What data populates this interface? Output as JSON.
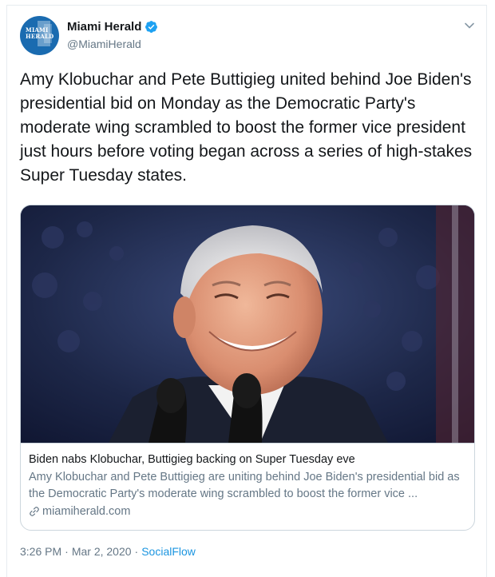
{
  "account": {
    "display_name": "Miami Herald",
    "handle": "@MiamiHerald",
    "avatar_text_line1": "MIAMI",
    "avatar_text_line2": "HERALD",
    "brand_color": "#1a6bb0",
    "verified_color": "#1da1f2"
  },
  "tweet": {
    "text": "Amy Klobuchar and Pete Buttigieg united behind Joe Biden's presidential bid on Monday as the Democratic Party's moderate wing scrambled to boost the former vice president just hours before voting began across a series of high-stakes Super Tuesday states."
  },
  "card": {
    "title": "Biden nabs Klobuchar, Buttigieg backing on Super Tuesday eve",
    "description": "Amy Klobuchar and Pete Buttigieg are uniting behind Joe Biden's presidential bid as the Democratic Party's moderate wing scrambled to boost the former vice ...",
    "domain": "miamiherald.com",
    "image_icon": "photo-of-joe-biden-smiling-at-microphones"
  },
  "meta": {
    "time": "3:26 PM",
    "separator": "·",
    "date": "Mar 2, 2020",
    "source": "SocialFlow"
  },
  "icons": {
    "verified": "verified-badge-icon",
    "caret": "chevron-down-icon",
    "link": "link-icon"
  }
}
